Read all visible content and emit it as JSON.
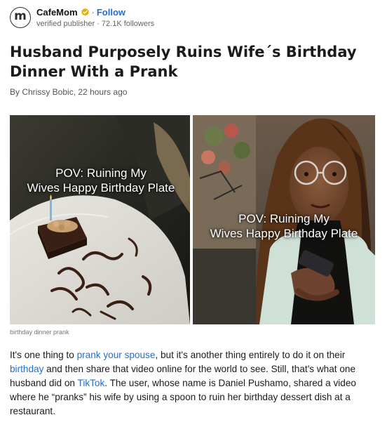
{
  "publisher": {
    "name": "CafeMom",
    "separator": "·",
    "follow_label": "Follow",
    "subtitle": "verified publisher · 72.1K followers",
    "logo_letter": "m",
    "verified_color": "#e0b010",
    "accent_color": "#1f6fd0"
  },
  "article": {
    "title": "Husband Purposely Ruins Wife´s Birthday Dinner With a Prank",
    "byline": "By Chrissy Bobic, 22 hours ago",
    "image_caption": "birthday dinner prank",
    "overlay_left": [
      "POV: Ruining My",
      "Wives Happy Birthday Plate"
    ],
    "overlay_right": [
      "POV: Ruining My",
      "Wives Happy Birthday Plate"
    ],
    "paragraph": {
      "t1": "It's one thing to ",
      "link1": "prank your spouse",
      "t2": ", but it's another thing entirely to do it on their ",
      "link2": "birthday",
      "t3": " and then share that video online for the world to see. Still, that's what one husband did on ",
      "link3": "TikTok",
      "t4": ". The user, whose name is Daniel Pushamo, shared a video where he “pranks” his wife by using a spoon to ruin her birthday dessert dish at a restaurant."
    }
  }
}
